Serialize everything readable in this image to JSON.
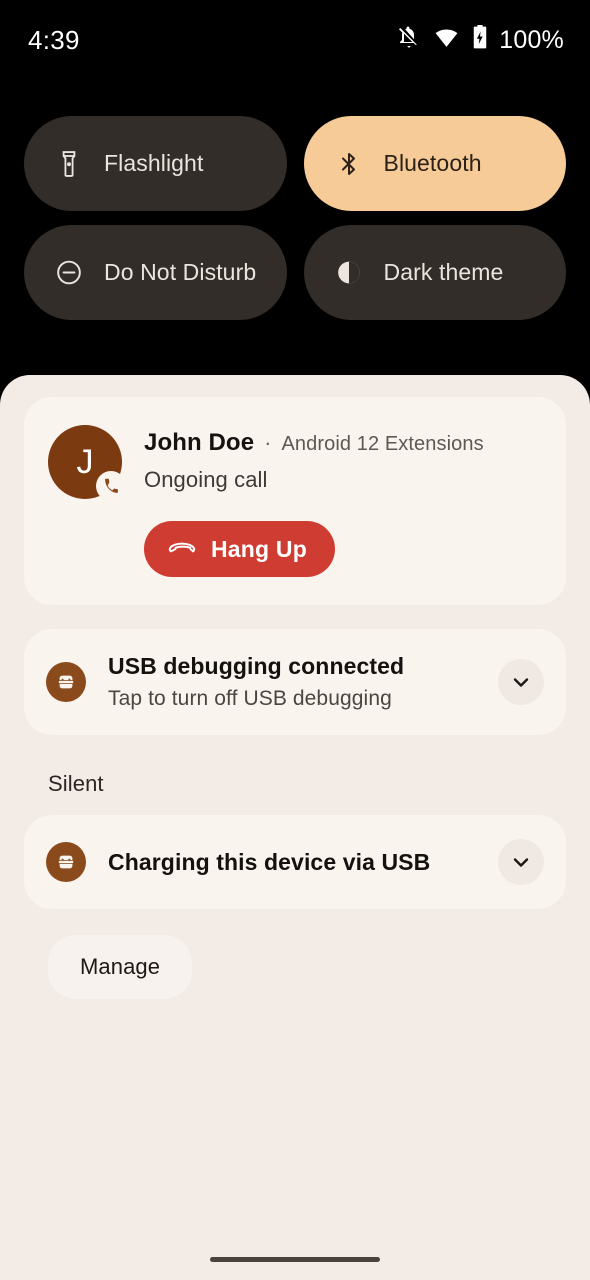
{
  "status_bar": {
    "clock": "4:39",
    "battery_percent": "100%",
    "icons": [
      {
        "name": "notifications-off-icon",
        "label": "Notifications silenced"
      },
      {
        "name": "wifi-icon",
        "label": "Wi-Fi connected"
      },
      {
        "name": "battery-charging-icon",
        "label": "Battery charging"
      }
    ]
  },
  "quick_settings": {
    "tiles": [
      {
        "label": "Flashlight",
        "icon": "flashlight-icon",
        "active": false
      },
      {
        "label": "Bluetooth",
        "icon": "bluetooth-icon",
        "active": true
      },
      {
        "label": "Do Not Disturb",
        "icon": "do-not-disturb-icon",
        "active": false
      },
      {
        "label": "Dark theme",
        "icon": "dark-theme-icon",
        "active": false
      }
    ]
  },
  "notifications": {
    "call": {
      "avatar_initial": "J",
      "name": "John Doe",
      "separator": "·",
      "app_name": "Android 12 Extensions",
      "status": "Ongoing call",
      "action_label": "Hang Up",
      "action_icon": "call-end-icon",
      "badge_icon": "phone-icon"
    },
    "usb_debugging": {
      "title": "USB debugging connected",
      "subtitle": "Tap to turn off USB debugging",
      "icon": "android-bug-icon",
      "expand_icon": "chevron-down-icon"
    },
    "silent_section_label": "Silent",
    "charging": {
      "title": "Charging this device via USB",
      "icon": "android-bug-icon",
      "expand_icon": "chevron-down-icon"
    },
    "manage_label": "Manage"
  },
  "colors": {
    "background": "#000000",
    "shade_background": "#f3ebe5",
    "card_background": "#faf4ef",
    "tile_inactive": "#322d28",
    "tile_active": "#f7cb97",
    "accent_brown": "#7b3a10",
    "hangup_red": "#cf3c31"
  }
}
